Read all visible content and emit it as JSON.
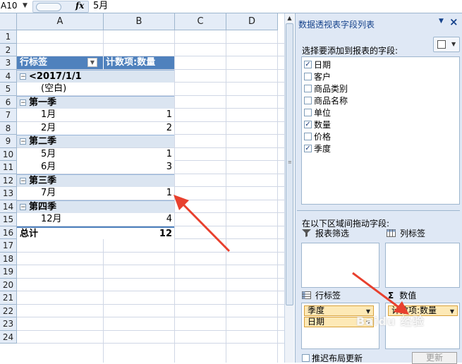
{
  "formula_bar": {
    "name_box": "A10",
    "fx": "fx",
    "content": "5月"
  },
  "sheet": {
    "columns": [
      "A",
      "B",
      "C",
      "D"
    ],
    "rows": [
      "1",
      "2",
      "3",
      "4",
      "5",
      "6",
      "7",
      "8",
      "9",
      "10",
      "11",
      "12",
      "13",
      "14",
      "15",
      "16",
      "17",
      "18",
      "19",
      "20",
      "21",
      "22",
      "23",
      "24"
    ],
    "pivot": {
      "header_label": "行标签",
      "header_value": "计数项:数量",
      "rows": [
        {
          "type": "group",
          "label": "<2017/1/1",
          "value": ""
        },
        {
          "type": "item",
          "label": "(空白)",
          "value": ""
        },
        {
          "type": "group",
          "label": "第一季",
          "value": ""
        },
        {
          "type": "item",
          "label": "1月",
          "value": "1"
        },
        {
          "type": "item",
          "label": "2月",
          "value": "2"
        },
        {
          "type": "group",
          "label": "第二季",
          "value": ""
        },
        {
          "type": "item",
          "label": "5月",
          "value": "1"
        },
        {
          "type": "item",
          "label": "6月",
          "value": "3"
        },
        {
          "type": "group",
          "label": "第三季",
          "value": ""
        },
        {
          "type": "item",
          "label": "7月",
          "value": "1"
        },
        {
          "type": "group",
          "label": "第四季",
          "value": ""
        },
        {
          "type": "item",
          "label": "12月",
          "value": "4"
        }
      ],
      "total_label": "总计",
      "total_value": "12",
      "collapse_symbol": "−"
    }
  },
  "panel": {
    "title": "数据透视表字段列表",
    "close": "×",
    "choose_label": "选择要添加到报表的字段:",
    "fields": [
      {
        "label": "日期",
        "checked": true
      },
      {
        "label": "客户",
        "checked": false
      },
      {
        "label": "商品类别",
        "checked": false
      },
      {
        "label": "商品名称",
        "checked": false
      },
      {
        "label": "单位",
        "checked": false
      },
      {
        "label": "数量",
        "checked": true
      },
      {
        "label": "价格",
        "checked": false
      },
      {
        "label": "季度",
        "checked": true
      }
    ],
    "drag_label": "在以下区域间拖动字段:",
    "areas": {
      "report_filter": "报表筛选",
      "column_labels": "列标签",
      "row_labels": "行标签",
      "values": "数值",
      "sigma": "Σ"
    },
    "row_pills": [
      "季度",
      "日期"
    ],
    "value_pills": [
      "计数项:数量"
    ],
    "defer_label": "推迟布局更新",
    "update_label": "更新",
    "check_mark": "✓"
  },
  "watermark": "Baidu 经验",
  "colors": {
    "pivot_header": "#4f81bd",
    "pivot_group": "#dbe5f1",
    "arrow": "#e8402e",
    "pill": "#fde9b6"
  }
}
